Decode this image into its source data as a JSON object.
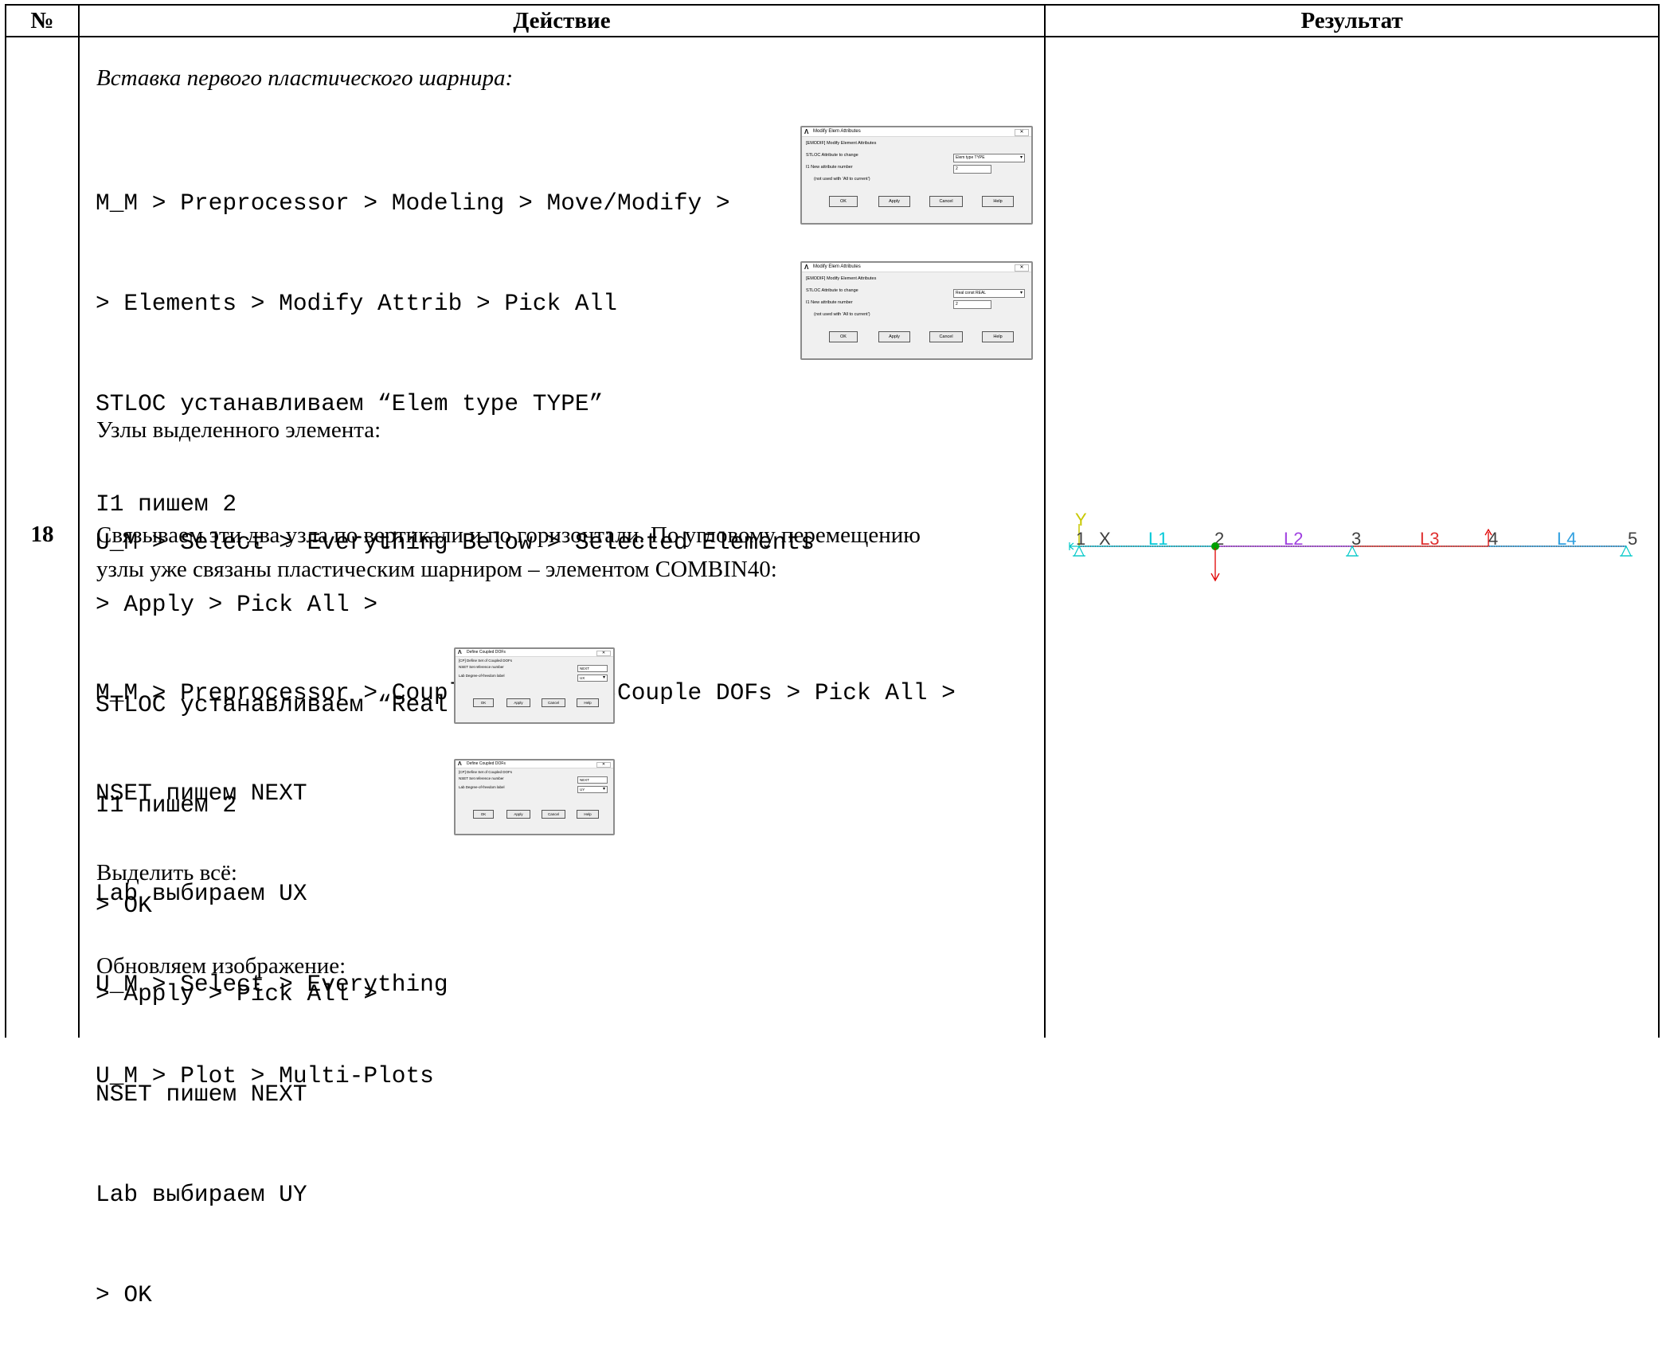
{
  "table": {
    "headers": {
      "num": "№",
      "action": "Действие",
      "result": "Результат"
    },
    "row": {
      "number": "18",
      "blocks": [
        {
          "kind": "italic",
          "text": "Вставка первого пластического шарнира:"
        },
        {
          "kind": "mono",
          "lines": [
            "M_M > Preprocessor > Modeling > Move/Modify >",
            "> Elements > Modify Attrib > Pick All",
            "STLOC устанавливаем “Elem type TYPE”",
            "I1 пишем 2",
            "> Apply > Pick All >",
            "STLOC устанавливаем “Real const REAL”",
            "I1 пишем 2",
            "> OK"
          ]
        },
        {
          "kind": "text",
          "text": "Узлы выделенного элемента:"
        },
        {
          "kind": "mono",
          "lines": [
            "U_M > Select > Everything Below > Selected Elements"
          ]
        },
        {
          "kind": "text",
          "lines": [
            "Связываем эти два узла по вертикали и по горизонтали. По угловому перемещению",
            "узлы уже связаны пластическим шарниром – элементом COMBIN40:"
          ]
        },
        {
          "kind": "mono",
          "lines": [
            "M_M > Preprocessor > Coupling/Ceqn > Couple DOFs > Pick All >",
            "NSET пишем NEXT",
            "Lab выбираем UX",
            "> Apply > Pick All >",
            "NSET пишем NEXT",
            "Lab выбираем UY",
            "> OK"
          ]
        },
        {
          "kind": "text",
          "text": "Выделить всё:"
        },
        {
          "kind": "mono",
          "lines": [
            "U_M > Select > Everything"
          ]
        },
        {
          "kind": "text",
          "text": "Обновляем изображение:"
        },
        {
          "kind": "mono",
          "lines": [
            "U_M > Plot > Multi-Plots"
          ]
        }
      ]
    }
  },
  "dialogs": {
    "modify_1": {
      "title": "Modify Elem Attributes",
      "subtitle": "[EMODIF] Modify Element Attributes",
      "stloc_label": "STLOC  Attribute to change",
      "stloc_value": "Elem type  TYPE",
      "i1_label": "I1    New attribute number",
      "i1_value": "2",
      "note": "(not used with 'All to current')",
      "buttons": [
        "OK",
        "Apply",
        "Cancel",
        "Help"
      ]
    },
    "modify_2": {
      "title": "Modify Elem Attributes",
      "subtitle": "[EMODIF] Modify Element Attributes",
      "stloc_label": "STLOC  Attribute to change",
      "stloc_value": "Real const  REAL",
      "i1_label": "I1    New attribute number",
      "i1_value": "2",
      "note": "(not used with 'All to current')",
      "buttons": [
        "OK",
        "Apply",
        "Cancel",
        "Help"
      ]
    },
    "couple_1": {
      "title": "Define Coupled DOFs",
      "subtitle": "[CP]  Define Set of Coupled DOFs",
      "nset_label": "NSET  Set reference number",
      "nset_value": "NEXT",
      "lab_label": "Lab   Degree-of-freedom label",
      "lab_value": "UX",
      "buttons": [
        "OK",
        "Apply",
        "Cancel",
        "Help"
      ]
    },
    "couple_2": {
      "title": "Define Coupled DOFs",
      "subtitle": "[CP]  Define Set of Coupled DOFs",
      "nset_label": "NSET  Set reference number",
      "nset_value": "NEXT",
      "lab_label": "Lab   Degree-of-freedom label",
      "lab_value": "UY",
      "buttons": [
        "OK",
        "Apply",
        "Cancel",
        "Help"
      ]
    }
  },
  "result_plot": {
    "axis_labels": {
      "y": "Y",
      "x": "X"
    },
    "node_labels": [
      "1",
      "2",
      "3",
      "4",
      "5"
    ],
    "line_labels": [
      "L1",
      "L2",
      "L3",
      "L4"
    ],
    "colors": {
      "axis": "#c8c800",
      "line1": "#00b0c8",
      "line2": "#9b30d0",
      "line3": "#d02020",
      "line4": "#2090d0",
      "support": "#00c8c8",
      "load": "#e00000",
      "hinge": "#00a000"
    }
  }
}
